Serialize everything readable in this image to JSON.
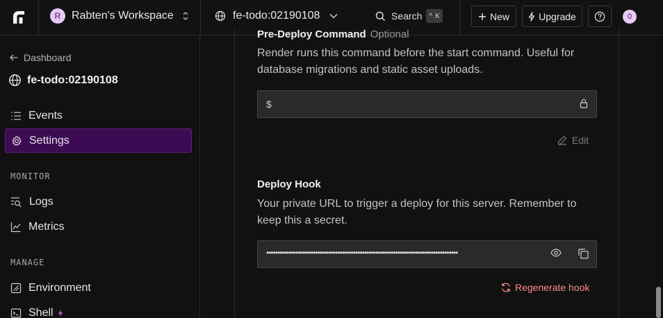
{
  "topbar": {
    "workspace": {
      "initial": "R",
      "name": "Rabten's Workspace"
    },
    "service": {
      "name": "fe-todo:02190108"
    },
    "search": {
      "label": "Search",
      "shortcut_mod": "^",
      "shortcut_key": "K"
    },
    "new_label": "New",
    "upgrade_label": "Upgrade",
    "notifications_count": "0"
  },
  "sidebar": {
    "back_label": "Dashboard",
    "service_title": "fe-todo:02190108",
    "items": [
      {
        "label": "Events",
        "icon": "list-icon"
      },
      {
        "label": "Settings",
        "icon": "gear-icon",
        "active": true
      }
    ],
    "monitor_label": "MONITOR",
    "monitor_items": [
      {
        "label": "Logs",
        "icon": "logs-search-icon"
      },
      {
        "label": "Metrics",
        "icon": "chart-icon"
      }
    ],
    "manage_label": "MANAGE",
    "manage_items": [
      {
        "label": "Environment",
        "icon": "environment-icon"
      },
      {
        "label": "Shell",
        "icon": "terminal-icon",
        "badge_icon": "bolt-icon"
      }
    ]
  },
  "main": {
    "pre_deploy": {
      "title": "Pre-Deploy Command",
      "optional": "Optional",
      "description": "Render runs this command before the start command. Useful for database migrations and static asset uploads.",
      "prefix": "$",
      "value": "",
      "edit_label": "Edit"
    },
    "deploy_hook": {
      "title": "Deploy Hook",
      "description": "Your private URL to trigger a deploy for this server. Remember to keep this a secret.",
      "masked_value": "••••••••••••••••••••••••••••••••••••••••••••••••••••••••••••••••••••••••••••••••••••••",
      "regenerate_label": "Regenerate hook"
    }
  },
  "colors": {
    "background": "#111111",
    "active_nav": "#3d0b54",
    "accent_avatar": "#e6c9f6",
    "danger": "#ff8b8b"
  }
}
